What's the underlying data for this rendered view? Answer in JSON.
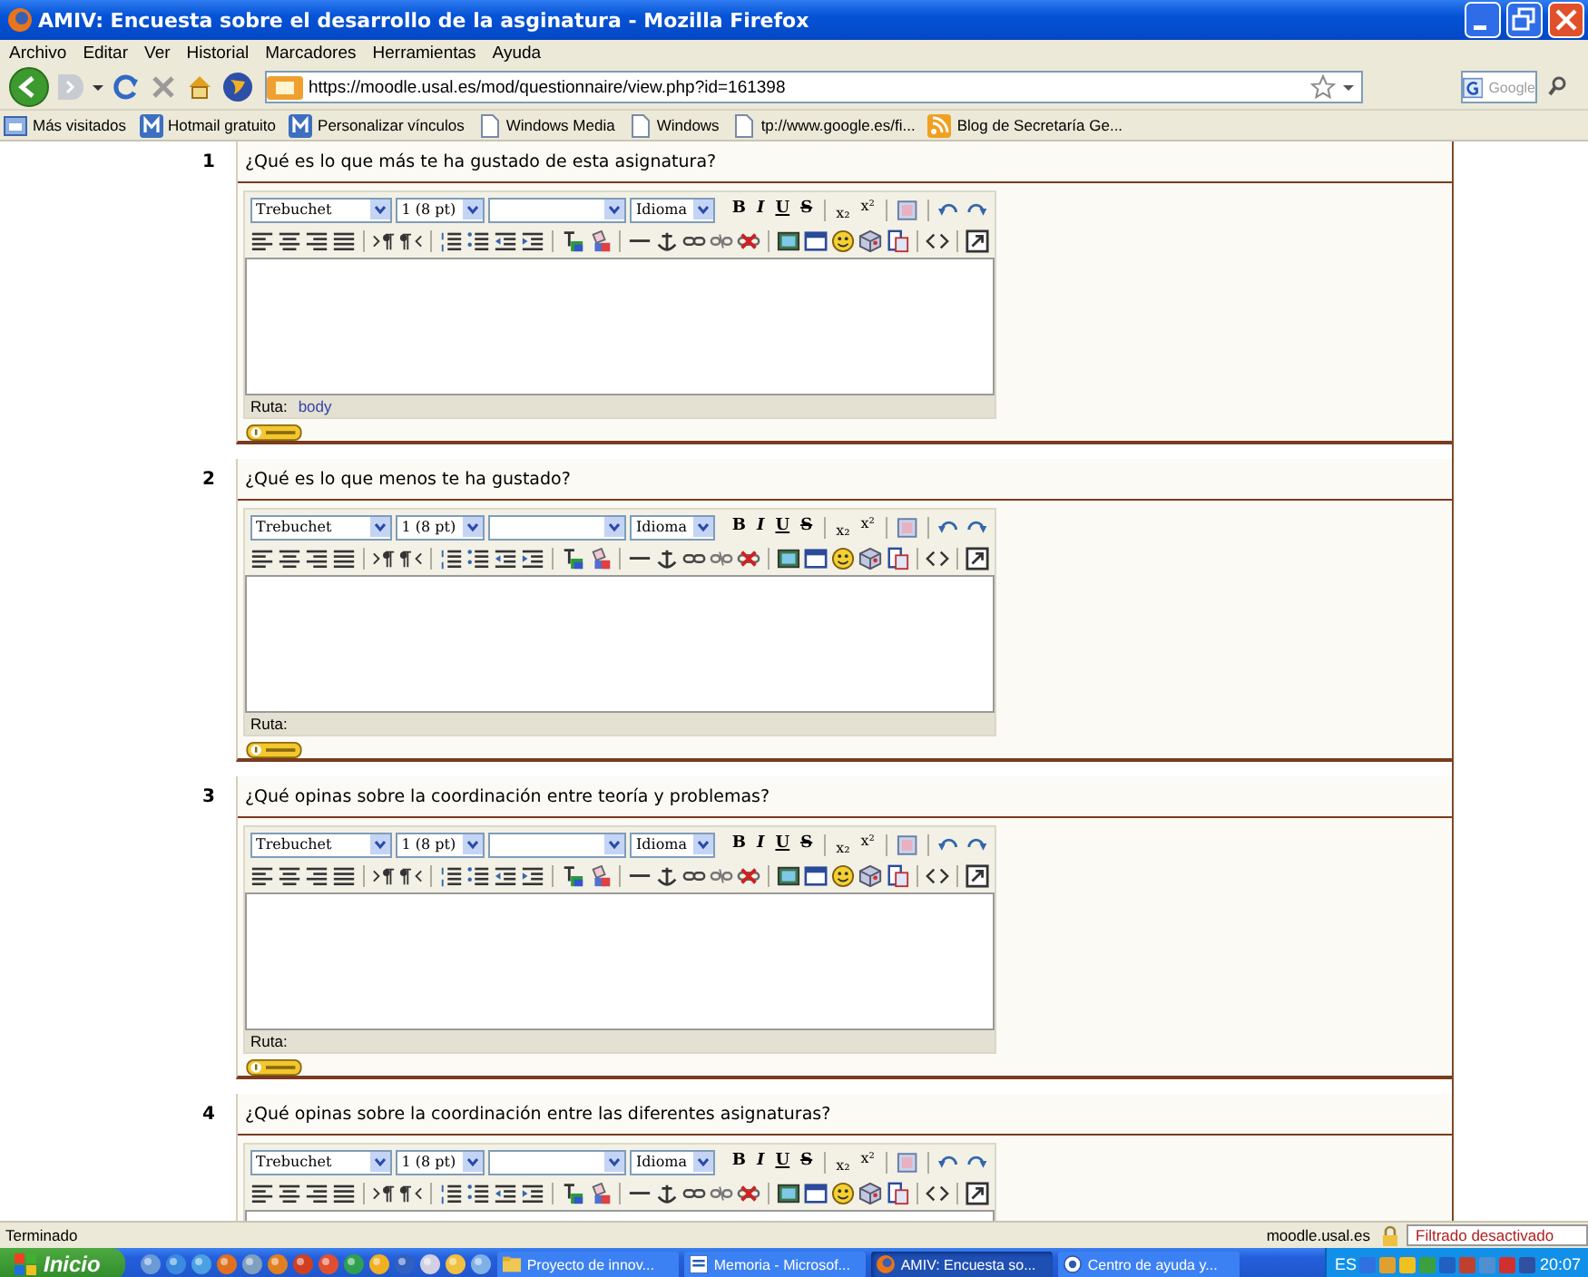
{
  "window": {
    "title": "AMIV: Encuesta sobre el desarrollo de la asginatura - Mozilla Firefox"
  },
  "menu": [
    "Archivo",
    "Editar",
    "Ver",
    "Historial",
    "Marcadores",
    "Herramientas",
    "Ayuda"
  ],
  "address_bar": {
    "url": "https://moodle.usal.es/mod/questionnaire/view.php?id=161398"
  },
  "search_field": {
    "placeholder": "Google"
  },
  "bookmarks": [
    {
      "label": "Más visitados",
      "kind": "folder"
    },
    {
      "label": "Hotmail gratuito",
      "kind": "site"
    },
    {
      "label": "Personalizar vínculos",
      "kind": "site"
    },
    {
      "label": "Windows Media",
      "kind": "page"
    },
    {
      "label": "Windows",
      "kind": "page"
    },
    {
      "label": "tp://www.google.es/fi...",
      "kind": "page"
    },
    {
      "label": "Blog de Secretaría Ge...",
      "kind": "feed"
    }
  ],
  "questions": [
    {
      "number": "1",
      "text": "¿Qué es lo que más te ha gustado de esta asignatura?",
      "editor": {
        "font": "Trebuchet",
        "size": "1 (8 pt)",
        "language": "Idioma",
        "format_buttons": [
          {
            "label": "B",
            "kind": "bold"
          },
          {
            "label": "I",
            "kind": "italic"
          },
          {
            "label": "U",
            "kind": "underline"
          },
          {
            "label": "S",
            "kind": "strike"
          }
        ],
        "script_buttons": [
          {
            "label": "x₂",
            "kind": "sub"
          },
          {
            "label": "x²",
            "kind": "sup"
          }
        ],
        "path_label": "Ruta:",
        "path": "body"
      }
    },
    {
      "number": "2",
      "text": "¿Qué es lo que menos te ha gustado?",
      "editor": {
        "font": "Trebuchet",
        "size": "1 (8 pt)",
        "language": "Idioma",
        "format_buttons": [
          {
            "label": "B",
            "kind": "bold"
          },
          {
            "label": "I",
            "kind": "italic"
          },
          {
            "label": "U",
            "kind": "underline"
          },
          {
            "label": "S",
            "kind": "strike"
          }
        ],
        "script_buttons": [
          {
            "label": "x₂",
            "kind": "sub"
          },
          {
            "label": "x²",
            "kind": "sup"
          }
        ],
        "path_label": "Ruta:"
      }
    },
    {
      "number": "3",
      "text": "¿Qué opinas sobre la coordinación entre teoría y problemas?",
      "editor": {
        "font": "Trebuchet",
        "size": "1 (8 pt)",
        "language": "Idioma",
        "format_buttons": [
          {
            "label": "B",
            "kind": "bold"
          },
          {
            "label": "I",
            "kind": "italic"
          },
          {
            "label": "U",
            "kind": "underline"
          },
          {
            "label": "S",
            "kind": "strike"
          }
        ],
        "script_buttons": [
          {
            "label": "x₂",
            "kind": "sub"
          },
          {
            "label": "x²",
            "kind": "sup"
          }
        ],
        "path_label": "Ruta:"
      }
    },
    {
      "number": "4",
      "text": "¿Qué opinas sobre la coordinación entre las diferentes asignaturas?",
      "editor": {
        "font": "Trebuchet",
        "size": "1 (8 pt)",
        "language": "Idioma",
        "format_buttons": [
          {
            "label": "B",
            "kind": "bold"
          },
          {
            "label": "I",
            "kind": "italic"
          },
          {
            "label": "U",
            "kind": "underline"
          },
          {
            "label": "S",
            "kind": "strike"
          }
        ],
        "script_buttons": [
          {
            "label": "x₂",
            "kind": "sub"
          },
          {
            "label": "x²",
            "kind": "sup"
          }
        ]
      }
    }
  ],
  "status_bar": {
    "text": "Terminado",
    "host": "moodle.usal.es",
    "filter": "Filtrado desactivado"
  },
  "taskbar": {
    "start": "Inicio",
    "tasks": [
      {
        "label": "Proyecto de innov...",
        "kind": "folder",
        "selected": false
      },
      {
        "label": "Memoria - Microsof...",
        "kind": "document",
        "selected": false
      },
      {
        "label": "AMIV: Encuesta so...",
        "kind": "browser",
        "selected": true
      },
      {
        "label": "Centro de ayuda y...",
        "kind": "help",
        "selected": false
      }
    ],
    "language": "ES",
    "clock": "20:07"
  }
}
